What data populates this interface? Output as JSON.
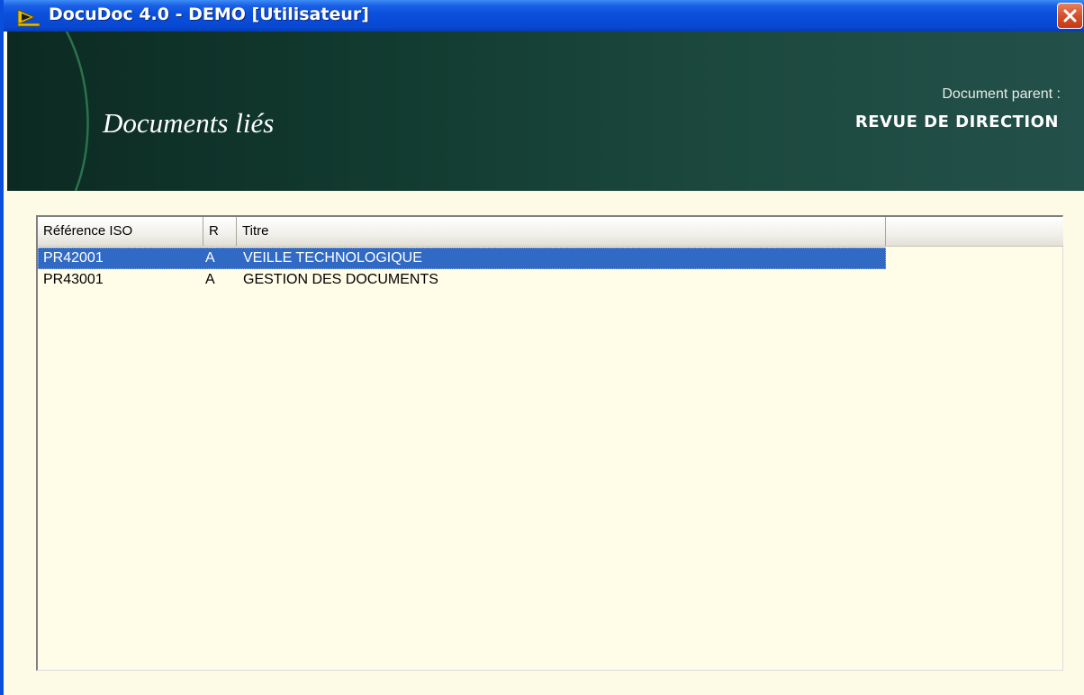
{
  "window": {
    "title": "DocuDoc 4.0 - DEMO [Utilisateur]",
    "icons": {
      "app": "docudoc-logo-icon",
      "close": "close-icon"
    },
    "colors": {
      "titlebar": "#0a4fdc",
      "close": "#d6502c",
      "background": "#fdfbe6",
      "selection": "#316ac5",
      "banner": "#123b30"
    }
  },
  "banner": {
    "title": "Documents liés",
    "parent_label": "Document parent :",
    "parent_value": "REVUE DE DIRECTION"
  },
  "list": {
    "columns": [
      "Référence ISO",
      "R",
      "Titre"
    ],
    "rows": [
      {
        "ref": "PR42001",
        "rev": "A",
        "title": "VEILLE TECHNOLOGIQUE",
        "selected": true
      },
      {
        "ref": "PR43001",
        "rev": "A",
        "title": "GESTION DES DOCUMENTS",
        "selected": false
      }
    ]
  }
}
